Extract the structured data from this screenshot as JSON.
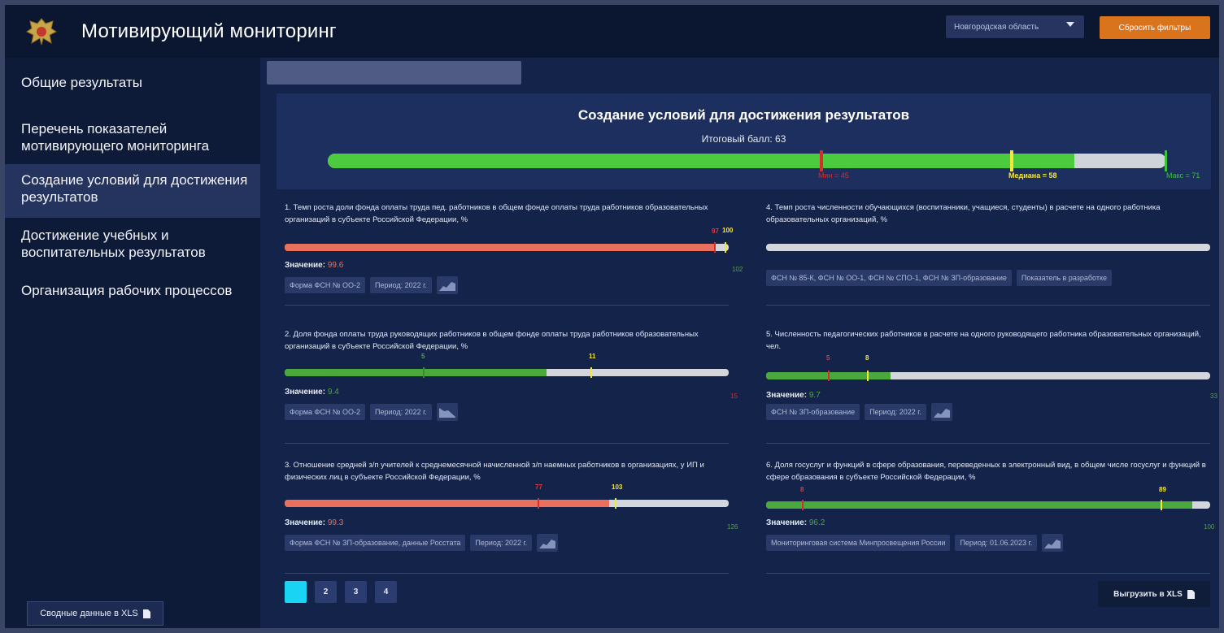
{
  "app": {
    "title": "Мотивирующий мониторинг"
  },
  "header": {
    "region": "Новгородская область",
    "reset_label": "Сбросить фильтры"
  },
  "sidebar": {
    "items": [
      {
        "label": "Общие результаты"
      },
      {
        "label": "Перечень показателей мотивирующего мониторинга"
      },
      {
        "label": "Создание условий для достижения результатов"
      },
      {
        "label": "Достижение учебных и воспитательных результатов"
      },
      {
        "label": "Организация рабочих процессов"
      }
    ],
    "xls_label": "Сводные данные в XLS"
  },
  "panel": {
    "title": "Создание условий для достижения результатов",
    "score_text": "Итоговый балл: 63",
    "score": 63,
    "min_label": "Мин = 45",
    "median_label": "Медиана = 58",
    "max_label": "Макс = 71"
  },
  "cards": [
    {
      "title": "1. Темп роста доли фонда оплаты труда пед. работников в общем фонде оплаты труда работников образовательных организаций в субъекте Российской Федерации, %",
      "value_label": "Значение:",
      "value": "99.6",
      "min_mark": "97",
      "median_mark": "100",
      "max_label": "102",
      "tags": [
        "Форма ФСН № ОО-2",
        "Период: 2022 г."
      ],
      "fill_color": "#e8705c"
    },
    {
      "title": "2. Доля фонда оплаты труда руководящих работников в общем фонде оплаты труда работников образовательных организаций в субъекте Российской Федерации, %",
      "value_label": "Значение:",
      "value": "9.4",
      "min_mark": "5",
      "median_mark": "11",
      "max_label": "15",
      "tags": [
        "Форма ФСН № ОО-2",
        "Период: 2022 г."
      ],
      "fill_color": "#4aa83c"
    },
    {
      "title": "3. Отношение средней з/п учителей к среднемесячной начисленной з/п наемных работников в организациях, у ИП и физических лиц в субъекте Российской Федерации, %",
      "value_label": "Значение:",
      "value": "99.3",
      "min_mark": "77",
      "median_mark": "103",
      "max_label": "126",
      "tags": [
        "Форма ФСН № ЗП-образование, данные Росстата",
        "Период: 2022 г."
      ],
      "fill_color": "#e8705c"
    },
    {
      "title": "4. Темп роста численности обучающихся (воспитанники, учащиеся, студенты) в расчете на одного работника образовательных организаций, %",
      "value_label": "",
      "value": "",
      "min_mark": "",
      "median_mark": "",
      "max_label": "",
      "tags": [
        "ФСН № 85-К, ФСН № ОО-1, ФСН № СПО-1, ФСН № ЗП-образование",
        "Показатель в разработке"
      ],
      "fill_color": "#4aa83c"
    },
    {
      "title": "5. Численность педагогических работников в расчете на одного руководящего работника образовательных организаций, чел.",
      "value_label": "Значение:",
      "value": "9.7",
      "min_mark": "5",
      "median_mark": "8",
      "max_label": "33",
      "tags": [
        "ФСН № ЗП-образование",
        "Период: 2022 г."
      ],
      "fill_color": "#4aa83c"
    },
    {
      "title": "6. Доля госуслуг и функций в сфере образования, переведенных в электронный вид, в общем числе госуслуг и функций в сфере образования в субъекте Российской Федерации, %",
      "value_label": "Значение:",
      "value": "96.2",
      "min_mark": "8",
      "median_mark": "89",
      "max_label": "100",
      "tags": [
        "Мониторинговая система Минпросвещения России",
        "Период: 01.06.2023 г."
      ],
      "fill_color": "#4aa83c"
    }
  ],
  "pager": {
    "pages": [
      "1",
      "2",
      "3",
      "4"
    ],
    "active": 0
  },
  "export": {
    "label": "Выгрузить в XLS"
  },
  "colors": {
    "accent": "#19d4f2",
    "reset": "#d9731c",
    "good": "#4ccb3e",
    "bad": "#e8705c",
    "median": "#f5e63a",
    "min": "#d62d2d"
  }
}
